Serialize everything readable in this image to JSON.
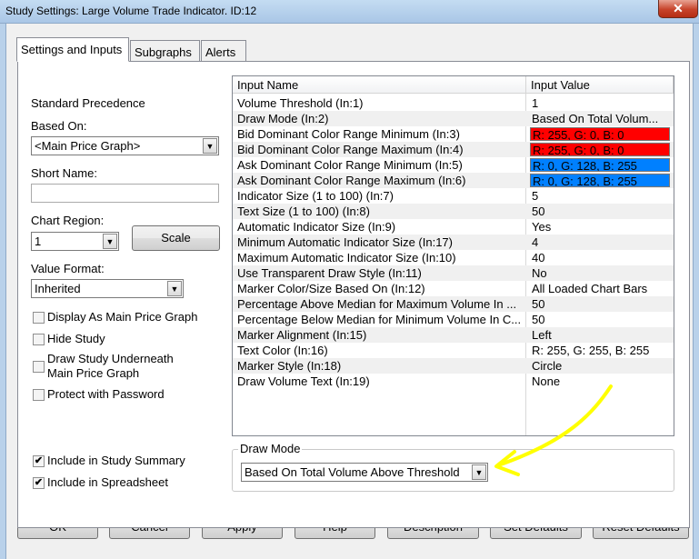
{
  "window": {
    "title": "Study Settings: Large Volume Trade Indicator. ID:12",
    "close_glyph": "✕"
  },
  "tabs": [
    {
      "label": "Settings and Inputs"
    },
    {
      "label": "Subgraphs"
    },
    {
      "label": "Alerts"
    }
  ],
  "left": {
    "standard_precedence": "Standard Precedence",
    "based_on_label": "Based On:",
    "based_on_value": "<Main Price Graph>",
    "short_name_label": "Short Name:",
    "short_name_value": "",
    "chart_region_label": "Chart Region:",
    "chart_region_value": "1",
    "scale_button": "Scale",
    "value_format_label": "Value Format:",
    "value_format_value": "Inherited",
    "checkboxes": [
      {
        "label": "Display As Main Price Graph",
        "checked": false
      },
      {
        "label": "Hide Study",
        "checked": false
      },
      {
        "label": "Draw Study Underneath",
        "label2": "Main Price Graph",
        "checked": false
      },
      {
        "label": "Protect with Password",
        "checked": false
      },
      {
        "label": "Include in Study Summary",
        "checked": true
      },
      {
        "label": "Include in Spreadsheet",
        "checked": true
      }
    ]
  },
  "grid": {
    "headers": {
      "name": "Input Name",
      "value": "Input Value"
    },
    "rows": [
      {
        "name": "Volume Threshold  (In:1)",
        "value": "1"
      },
      {
        "name": "Draw Mode  (In:2)",
        "value": "Based On Total Volum..."
      },
      {
        "name": "Bid Dominant Color Range Minimum  (In:3)",
        "value": "R: 255, G: 0, B: 0",
        "swatch": "#ff0000"
      },
      {
        "name": "Bid Dominant Color Range Maximum  (In:4)",
        "value": "R: 255, G: 0, B: 0",
        "swatch": "#ff0000"
      },
      {
        "name": "Ask Dominant Color Range Minimum  (In:5)",
        "value": "R: 0, G: 128, B: 255",
        "swatch": "#0080ff"
      },
      {
        "name": "Ask Dominant Color Range Maximum  (In:6)",
        "value": "R: 0, G: 128, B: 255",
        "swatch": "#0080ff"
      },
      {
        "name": "Indicator Size (1 to 100)  (In:7)",
        "value": "5"
      },
      {
        "name": "Text Size (1 to 100)  (In:8)",
        "value": "50"
      },
      {
        "name": "Automatic Indicator Size  (In:9)",
        "value": "Yes"
      },
      {
        "name": "Minimum Automatic Indicator Size  (In:17)",
        "value": "4"
      },
      {
        "name": "Maximum Automatic Indicator Size  (In:10)",
        "value": "40"
      },
      {
        "name": "Use Transparent Draw Style  (In:11)",
        "value": "No"
      },
      {
        "name": "Marker Color/Size Based On  (In:12)",
        "value": "All Loaded Chart Bars"
      },
      {
        "name": "Percentage Above Median for Maximum Volume In ...",
        "value": "50"
      },
      {
        "name": "Percentage Below Median for Minimum Volume In C...",
        "value": "50"
      },
      {
        "name": "Marker Alignment  (In:15)",
        "value": "Left"
      },
      {
        "name": "Text Color  (In:16)",
        "value": "R: 255, G: 255, B: 255"
      },
      {
        "name": "Marker Style  (In:18)",
        "value": "Circle"
      },
      {
        "name": "Draw Volume Text  (In:19)",
        "value": "None"
      }
    ]
  },
  "draw_mode": {
    "group_label": "Draw Mode",
    "value": "Based On Total Volume Above Threshold"
  },
  "buttons": {
    "ok": "OK",
    "cancel": "Cancel",
    "apply": "Apply",
    "help": "Help",
    "description": "Description",
    "set_defaults": "Set Defaults",
    "reset_defaults": "Reset Defaults"
  },
  "colors": {
    "annotation_arrow": "#ffff00"
  }
}
